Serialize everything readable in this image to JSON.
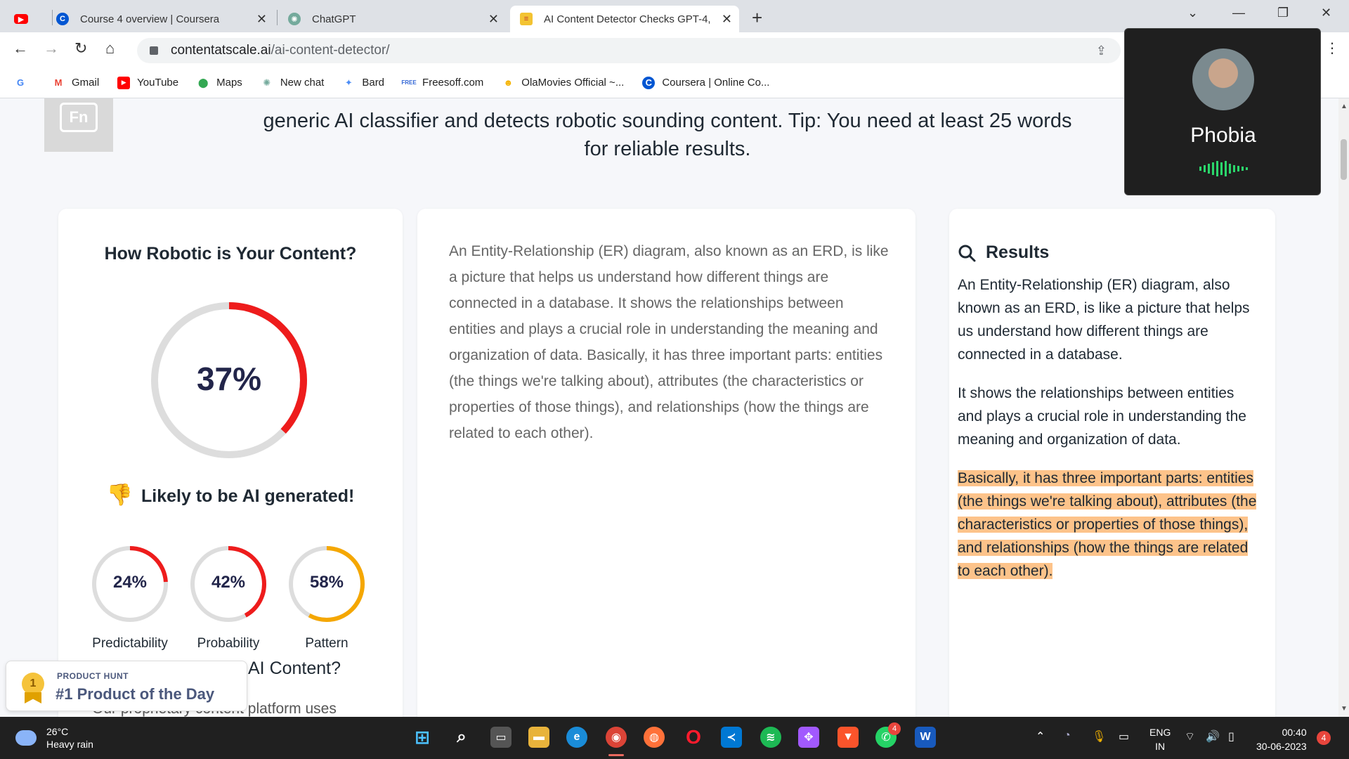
{
  "browser": {
    "tabs": [
      {
        "title": "",
        "icon": "youtube-icon"
      },
      {
        "title": "Course 4 overview | Coursera",
        "icon": "coursera-icon"
      },
      {
        "title": "ChatGPT",
        "icon": "chatgpt-icon"
      },
      {
        "title": "AI Content Detector Checks GPT-4, (",
        "icon": "contentatscale-icon",
        "active": true
      }
    ],
    "url_host": "contentatscale.ai",
    "url_path": "/ai-content-detector/",
    "bookmarks": [
      {
        "label": "",
        "icon": "google-icon"
      },
      {
        "label": "Gmail",
        "icon": "gmail-icon"
      },
      {
        "label": "YouTube",
        "icon": "youtube-icon"
      },
      {
        "label": "Maps",
        "icon": "maps-icon"
      },
      {
        "label": "New chat",
        "icon": "chatgpt-icon"
      },
      {
        "label": "Bard",
        "icon": "bard-icon"
      },
      {
        "label": "Freesoff.com",
        "icon": "free-icon"
      },
      {
        "label": "OlaMovies Official ~...",
        "icon": "emoji-icon"
      },
      {
        "label": "Coursera | Online Co...",
        "icon": "coursera-icon"
      }
    ]
  },
  "page": {
    "intro_line": "generic AI classifier and detects robotic sounding content. Tip: You need at least 25 words",
    "intro_line2": "for reliable results.",
    "fn_label": "Fn",
    "score_card": {
      "title": "How Robotic is Your Content?",
      "score_label": "37%",
      "score_fraction": 0.37,
      "verdict": "Likely to be AI generated!",
      "metrics": [
        {
          "label": "Predictability",
          "value_label": "24%",
          "fraction": 0.24,
          "color": "#ee1c1c"
        },
        {
          "label": "Probability",
          "value_label": "42%",
          "fraction": 0.42,
          "color": "#ee1c1c"
        },
        {
          "label": "Pattern",
          "value_label": "58%",
          "fraction": 0.58,
          "color": "#f5a700"
        }
      ],
      "more_heading_partial": "AI Content?",
      "more_text_partial": "Our proprietary content platform uses"
    },
    "input_text": "An Entity-Relationship (ER) diagram, also known as an ERD, is like a picture that helps us understand how different things are connected in a database. It shows the relationships between entities and plays a crucial role in understanding the meaning and organization of data. Basically, it has three important parts: entities (the things we're talking about), attributes (the characteristics or properties of those things), and relationships (how the things are related to each other).",
    "results": {
      "heading": "Results",
      "paragraphs": [
        {
          "text": "An Entity-Relationship (ER) diagram, also known as an ERD, is like a picture that helps us understand how different things are connected in a database.",
          "highlighted": false
        },
        {
          "text": "It shows the relationships between entities and plays a crucial role in understanding the meaning and organization of data.",
          "highlighted": false
        },
        {
          "text": "Basically, it has three important parts: entities (the things we're talking about), attributes (the characteristics or properties of those things), and relationships (how the things are related to each other).",
          "highlighted": true
        }
      ]
    },
    "product_hunt": {
      "sub": "PRODUCT HUNT",
      "main": "#1 Product of the Day",
      "medal": "1"
    }
  },
  "call_overlay": {
    "name": "Phobia"
  },
  "taskbar": {
    "temperature": "26°C",
    "weather": "Heavy rain",
    "lang_top": "ENG",
    "lang_bottom": "IN",
    "time": "00:40",
    "date": "30-06-2023",
    "notifications": "4",
    "whatsapp_badge": "4"
  },
  "colors": {
    "gauge_red": "#ee1c1c",
    "gauge_track": "#dddddd",
    "highlight": "#fdc38a",
    "accent_orange": "#f5a700"
  }
}
